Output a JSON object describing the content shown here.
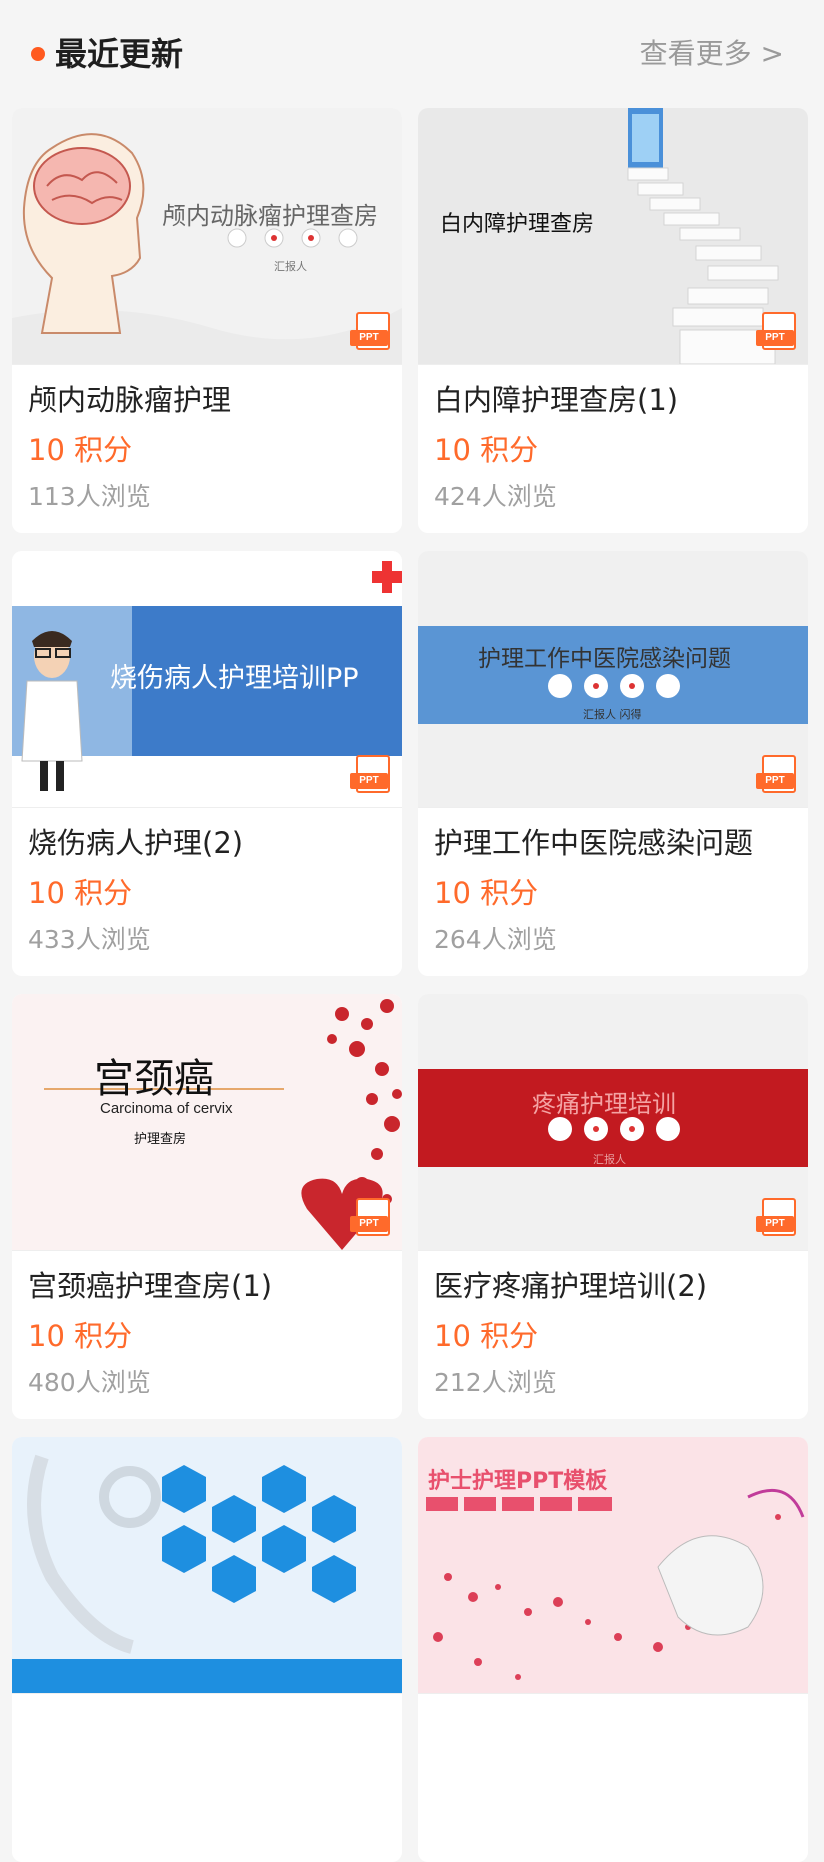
{
  "section": {
    "title": "最近更新",
    "more_label": "查看更多 >"
  },
  "badge_label": "PPT",
  "items": [
    {
      "name": "颅内动脉瘤护理",
      "price": "10 积分",
      "views": "113人浏览",
      "thumb_title": "颅内动脉瘤护理查房",
      "thumb_sub": "汇报人",
      "thumb_theme": "brain"
    },
    {
      "name": "白内障护理查房(1)",
      "price": "10 积分",
      "views": "424人浏览",
      "thumb_title": "白内障护理查房",
      "thumb_theme": "stairs"
    },
    {
      "name": "烧伤病人护理(2)",
      "price": "10 积分",
      "views": "433人浏览",
      "thumb_title": "烧伤病人护理培训PP",
      "thumb_theme": "doctor-blue"
    },
    {
      "name": "护理工作中医院感染问题",
      "price": "10 积分",
      "views": "264人浏览",
      "thumb_title": "护理工作中医院感染问题",
      "thumb_sub": "汇报人 闪得",
      "thumb_theme": "blue-band"
    },
    {
      "name": "宫颈癌护理查房(1)",
      "price": "10 积分",
      "views": "480人浏览",
      "thumb_title": "宫颈癌",
      "thumb_sub": "Carcinoma of cervix",
      "thumb_sub2": "护理查房",
      "thumb_theme": "hearts"
    },
    {
      "name": "医疗疼痛护理培训(2)",
      "price": "10 积分",
      "views": "212人浏览",
      "thumb_title": "疼痛护理培训",
      "thumb_sub": "汇报人",
      "thumb_theme": "red-band"
    },
    {
      "thumb_theme": "medical-icons"
    },
    {
      "thumb_title": "护士护理PPT模板",
      "thumb_theme": "pink-nurse"
    }
  ]
}
